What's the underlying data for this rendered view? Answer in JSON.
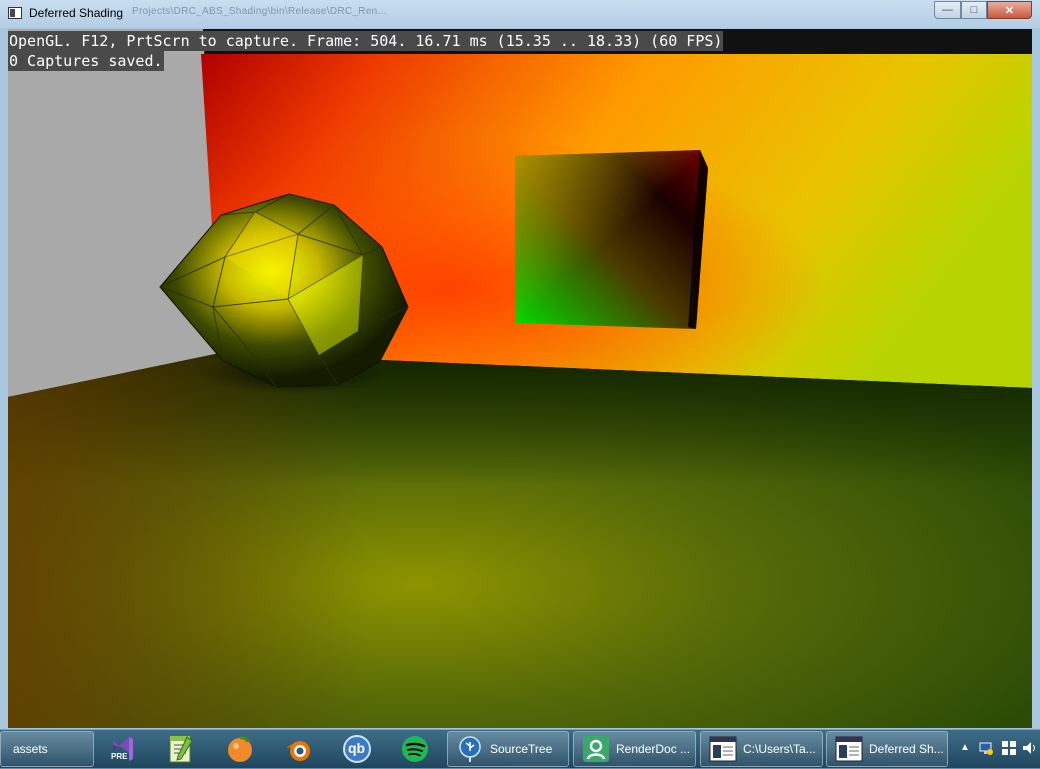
{
  "window": {
    "title": "Deferred Shading",
    "ghost_path": "Projects\\DRC_ABS_Shading\\bin\\Release\\DRC_Ren..."
  },
  "overlay": {
    "line1": "OpenGL. F12, PrtScrn to capture. Frame: 504. 16.71 ms (15.35 .. 18.33) (60 FPS)",
    "line2": "0 Captures saved."
  },
  "taskbar": {
    "items": [
      {
        "label": "assets",
        "icon": "folder-icon"
      },
      {
        "label": "PRE",
        "icon": "visual-studio-icon"
      },
      {
        "label": "",
        "icon": "notepad-plus-icon"
      },
      {
        "label": "",
        "icon": "clementine-icon"
      },
      {
        "label": "",
        "icon": "blender-icon"
      },
      {
        "label": "qb",
        "icon": "qbittorrent-icon"
      },
      {
        "label": "",
        "icon": "spotify-icon"
      },
      {
        "label": "SourceTree",
        "icon": "sourcetree-icon"
      },
      {
        "label": "RenderDoc ...",
        "icon": "renderdoc-icon"
      },
      {
        "label": "C:\\Users\\Ta...",
        "icon": "console-icon"
      },
      {
        "label": "Deferred Sh...",
        "icon": "app-window-icon"
      }
    ]
  }
}
